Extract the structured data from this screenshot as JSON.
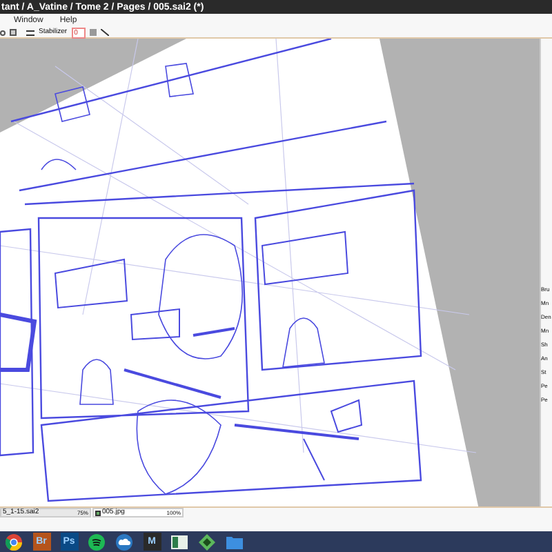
{
  "window": {
    "title": "tant / A_Vatine / Tome 2 / Pages / 005.sai2 (*)"
  },
  "menu": [
    "Window",
    "Help"
  ],
  "toolbar": {
    "stabilizer_label": "Stabilizer",
    "stabilizer_value": "0"
  },
  "document_tabs": [
    {
      "name": "5_1-15.sai2",
      "zoom": "75%",
      "selected": false
    },
    {
      "name": "005.jpg",
      "zoom": "100%",
      "selected": true
    }
  ],
  "tool_panel": {
    "labels": [
      "Bru",
      "Mn",
      "Den",
      "Mn",
      "Sh",
      "An",
      "St",
      "Pe",
      "Pe"
    ]
  },
  "taskbar": [
    {
      "kind": "browser"
    },
    {
      "kind": "app",
      "label": "Br",
      "color": "#b5541c"
    },
    {
      "kind": "app",
      "label": "Ps",
      "color": "#0a4a86"
    },
    {
      "kind": "music"
    },
    {
      "kind": "cloud"
    },
    {
      "kind": "app",
      "label": "M",
      "color": "#2a2a2a"
    },
    {
      "kind": "window"
    },
    {
      "kind": "diamond"
    },
    {
      "kind": "folder"
    }
  ]
}
